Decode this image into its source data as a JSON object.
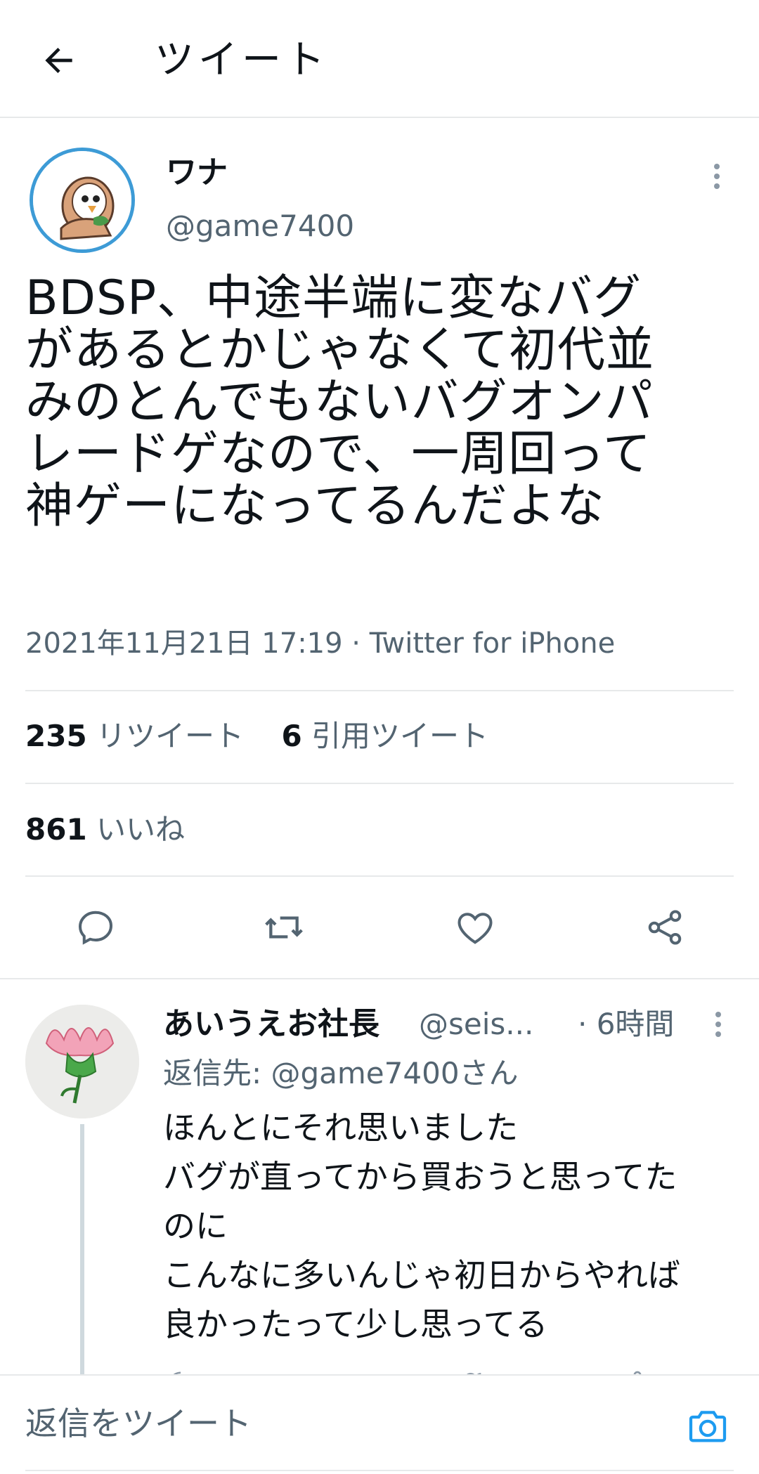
{
  "header": {
    "title": "ツイート"
  },
  "tweet": {
    "display_name": "ワナ",
    "handle": "@game7400",
    "text": "BDSP、中途半端に変なバグ\nがあるとかじゃなくて初代並\nみのとんでもないバグオンパ\nレードゲなので、一周回って\n神ゲーになってるんだよな",
    "meta": "2021年11月21日 17:19 · Twitter for iPhone",
    "retweets_count": "235",
    "retweets_label": "リツイート",
    "quotes_count": "6",
    "quotes_label": "引用ツイート",
    "likes_count": "861",
    "likes_label": "いいね"
  },
  "actions": {
    "icons": [
      "reply-icon",
      "retweet-icon",
      "like-icon",
      "share-icon"
    ]
  },
  "reply": {
    "display_name": "あいうえお社長",
    "handle": "@seis...",
    "time": "· 6時間",
    "reply_to": "返信先: @game7400さん",
    "text": "ほんとにそれ思いました\nバグが直ってから買おうと思ってた\nのに\nこんなに多いんじゃ初日からやれば\n良かったって少し思ってる"
  },
  "compose": {
    "placeholder": "返信をツイート",
    "camera_icon": "camera-icon"
  },
  "colors": {
    "accent": "#1d9bf0",
    "text": "#0f1419",
    "muted": "#536471",
    "divider": "#e7e9ea"
  }
}
